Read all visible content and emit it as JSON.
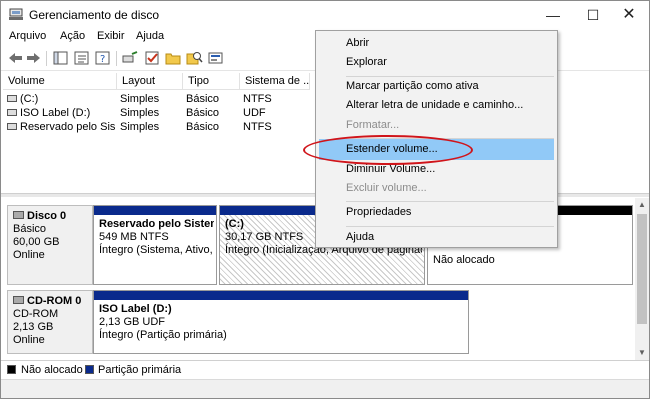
{
  "window": {
    "title": "Gerenciamento de disco",
    "controls": {
      "minimize": "—",
      "maximize": "☐",
      "close": "✕"
    }
  },
  "menubar": [
    "Arquivo",
    "Ação",
    "Exibir",
    "Ajuda"
  ],
  "volume_list": {
    "columns": [
      "Volume",
      "Layout",
      "Tipo",
      "Sistema de ..."
    ],
    "rows": [
      {
        "volume": "(C:)",
        "layout": "Simples",
        "tipo": "Básico",
        "sistema": "NTFS"
      },
      {
        "volume": "ISO Label (D:)",
        "layout": "Simples",
        "tipo": "Básico",
        "sistema": "UDF"
      },
      {
        "volume": "Reservado pelo Sis...",
        "layout": "Simples",
        "tipo": "Básico",
        "sistema": "NTFS"
      }
    ]
  },
  "disks": [
    {
      "name": "Disco 0",
      "type": "Básico",
      "size": "60,00 GB",
      "status": "Online",
      "partitions": [
        {
          "title": "Reservado pelo Sistema",
          "size": "549 MB NTFS",
          "status": "Íntegro (Sistema, Ativo, P"
        },
        {
          "title": "(C:)",
          "size": "30,17 GB NTFS",
          "status": "Íntegro (Inicialização, Arquivo de paginaçã"
        },
        {
          "title": "",
          "size": "",
          "status": "Não alocado"
        }
      ]
    },
    {
      "name": "CD-ROM 0",
      "type": "CD-ROM",
      "size": "2,13 GB",
      "status": "Online",
      "partitions": [
        {
          "title": "ISO Label  (D:)",
          "size": "2,13 GB UDF",
          "status": "Íntegro (Partição primária)"
        }
      ]
    }
  ],
  "legend": [
    {
      "label": "Não alocado",
      "color": "#000000"
    },
    {
      "label": "Partição primária",
      "color": "#0a2a8c"
    }
  ],
  "context_menu": {
    "items": [
      {
        "label": "Abrir",
        "state": "normal"
      },
      {
        "label": "Explorar",
        "state": "normal"
      },
      {
        "label": "Marcar partição como ativa",
        "state": "normal"
      },
      {
        "label": "Alterar letra de unidade e caminho...",
        "state": "normal"
      },
      {
        "label": "Formatar...",
        "state": "disabled"
      },
      {
        "label": "Estender volume...",
        "state": "highlighted"
      },
      {
        "label": "Diminuir Volume...",
        "state": "normal"
      },
      {
        "label": "Excluir volume...",
        "state": "disabled"
      },
      {
        "label": "Propriedades",
        "state": "normal"
      },
      {
        "label": "Ajuda",
        "state": "normal"
      }
    ]
  },
  "colors": {
    "primary_partition": "#0a2a8c",
    "unallocated": "#000000",
    "menu_highlight": "#91c9f7",
    "annotation": "#d0141a"
  },
  "icons": [
    "app-disk-icon",
    "back-arrow-icon",
    "forward-arrow-icon",
    "properties-icon",
    "help-icon",
    "rescan-icon",
    "check-icon",
    "folder-icon",
    "search-icon",
    "view-icon"
  ]
}
